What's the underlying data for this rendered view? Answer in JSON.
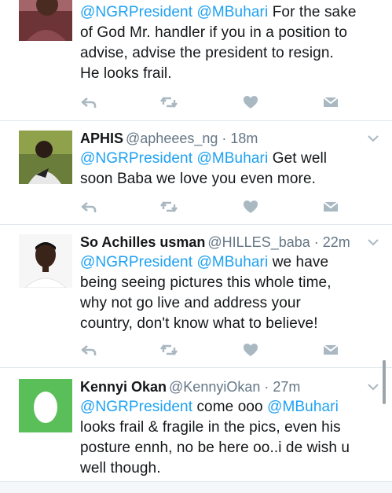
{
  "colors": {
    "accent": "#1da1f2",
    "muted": "#657786",
    "icon": "#aab8c2"
  },
  "tweets": [
    {
      "name": "",
      "handle": "",
      "time": "",
      "lines": [
        [
          {
            "t": "@NGRPresident",
            "m": true
          },
          {
            "t": " "
          },
          {
            "t": "@MBuhari",
            "m": true
          },
          {
            "t": " For the sake"
          }
        ],
        [
          {
            "t": "of God Mr. handler if you in a position to"
          }
        ],
        [
          {
            "t": "advise, advise the president to resign."
          }
        ],
        [
          {
            "t": "He looks frail."
          }
        ]
      ],
      "avatar_icon": "user-photo-avatar"
    },
    {
      "name": "APHIS",
      "handle": "@apheees_ng",
      "time": "18m",
      "lines": [
        [
          {
            "t": "@NGRPresident",
            "m": true
          },
          {
            "t": " "
          },
          {
            "t": "@MBuhari",
            "m": true
          },
          {
            "t": "  Get well"
          }
        ],
        [
          {
            "t": "soon Baba we love you even more."
          }
        ]
      ],
      "avatar_icon": "user-photo-avatar"
    },
    {
      "name": "So Achilles usman",
      "handle": "@HILLES_baba",
      "time": "22m",
      "lines": [
        [
          {
            "t": "@NGRPresident",
            "m": true
          },
          {
            "t": " "
          },
          {
            "t": "@MBuhari",
            "m": true
          },
          {
            "t": " we have"
          }
        ],
        [
          {
            "t": "being seeing pictures this whole time,"
          }
        ],
        [
          {
            "t": "why not go live and address your"
          }
        ],
        [
          {
            "t": "country, don't know what to believe!"
          }
        ]
      ],
      "avatar_icon": "user-photo-avatar"
    },
    {
      "name": "Kennyi Okan",
      "handle": "@KennyiOkan",
      "time": "27m",
      "lines": [
        [
          {
            "t": "@NGRPresident",
            "m": true
          },
          {
            "t": " come ooo "
          },
          {
            "t": "@MBuhari",
            "m": true
          }
        ],
        [
          {
            "t": "looks frail & fragile in the pics, even his"
          }
        ],
        [
          {
            "t": "posture ennh, no be here oo..i de wish u"
          }
        ],
        [
          {
            "t": "well though."
          }
        ]
      ],
      "avatar_icon": "default-egg-avatar"
    }
  ]
}
